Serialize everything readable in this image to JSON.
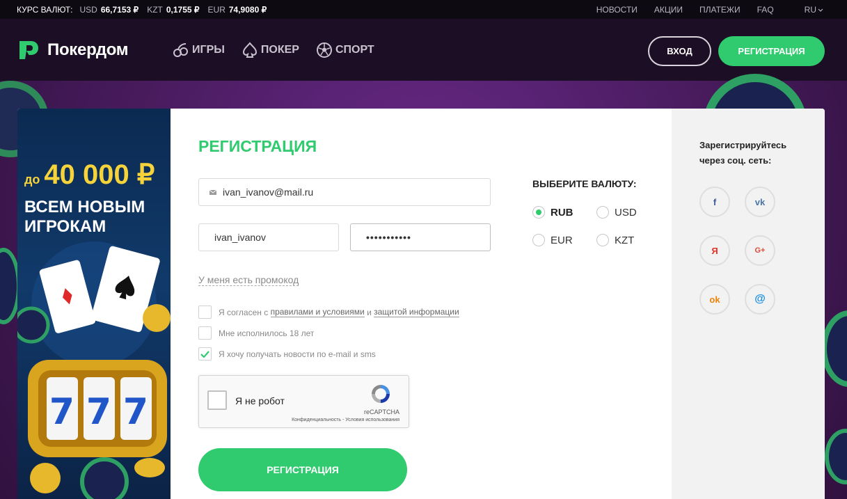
{
  "ticker": {
    "label": "КУРС ВАЛЮТ:",
    "rates": [
      {
        "code": "USD",
        "value": "66,7153 ₽"
      },
      {
        "code": "KZT",
        "value": "0,1755 ₽"
      },
      {
        "code": "EUR",
        "value": "74,9080 ₽"
      }
    ],
    "links": [
      "НОВОСТИ",
      "АКЦИИ",
      "ПЛАТЕЖИ",
      "FAQ"
    ],
    "lang": "RU"
  },
  "header": {
    "brand": "Покердом",
    "nav": [
      {
        "label": "ИГРЫ",
        "icon": "cherries-icon"
      },
      {
        "label": "ПОКЕР",
        "icon": "spade-icon"
      },
      {
        "label": "СПОРТ",
        "icon": "soccer-ball-icon"
      }
    ],
    "login_label": "ВХОД",
    "register_label": "РЕГИСТРАЦИЯ"
  },
  "promo": {
    "prefix": "до",
    "amount": "40 000 ₽",
    "tagline": "ВСЕМ НОВЫМ ИГРОКАМ"
  },
  "form": {
    "title": "РЕГИСТРАЦИЯ",
    "email_value": "ivan_ivanov@mail.ru",
    "login_value": "ivan_ivanov",
    "password_value": "•••••••••••",
    "promo_link": "У меня есть промокод",
    "agree_prefix": "Я согласен с ",
    "agree_rules": "правилами и условиями",
    "agree_and": " и ",
    "agree_privacy": "защитой информации",
    "age_label": "Мне исполнилось 18 лет",
    "news_label": "Я хочу получать новости по e-mail и sms",
    "captcha_label": "Я не робот",
    "captcha_brand": "reCAPTCHA",
    "captcha_legal": "Конфиденциальность - Условия использования",
    "submit_label": "РЕГИСТРАЦИЯ"
  },
  "currency": {
    "title": "ВЫБЕРИТЕ ВАЛЮТУ:",
    "options": [
      "RUB",
      "USD",
      "EUR",
      "KZT"
    ],
    "selected": "RUB"
  },
  "social": {
    "title": "Зарегистрируйтесь через соц. сеть:",
    "networks": [
      {
        "name": "facebook",
        "glyph": "f",
        "color": "#3b5998"
      },
      {
        "name": "vk",
        "glyph": "vk",
        "color": "#4a76a8"
      },
      {
        "name": "yandex",
        "glyph": "Я",
        "color": "#e5332a"
      },
      {
        "name": "google-plus",
        "glyph": "G+",
        "color": "#dd4b39"
      },
      {
        "name": "odnoklassniki",
        "glyph": "ok",
        "color": "#ee8208"
      },
      {
        "name": "mail",
        "glyph": "@",
        "color": "#168de2"
      }
    ]
  },
  "colors": {
    "accent": "#2fcb6e",
    "header_bg": "#1c0e24",
    "ticker_bg": "#0e0a12"
  }
}
